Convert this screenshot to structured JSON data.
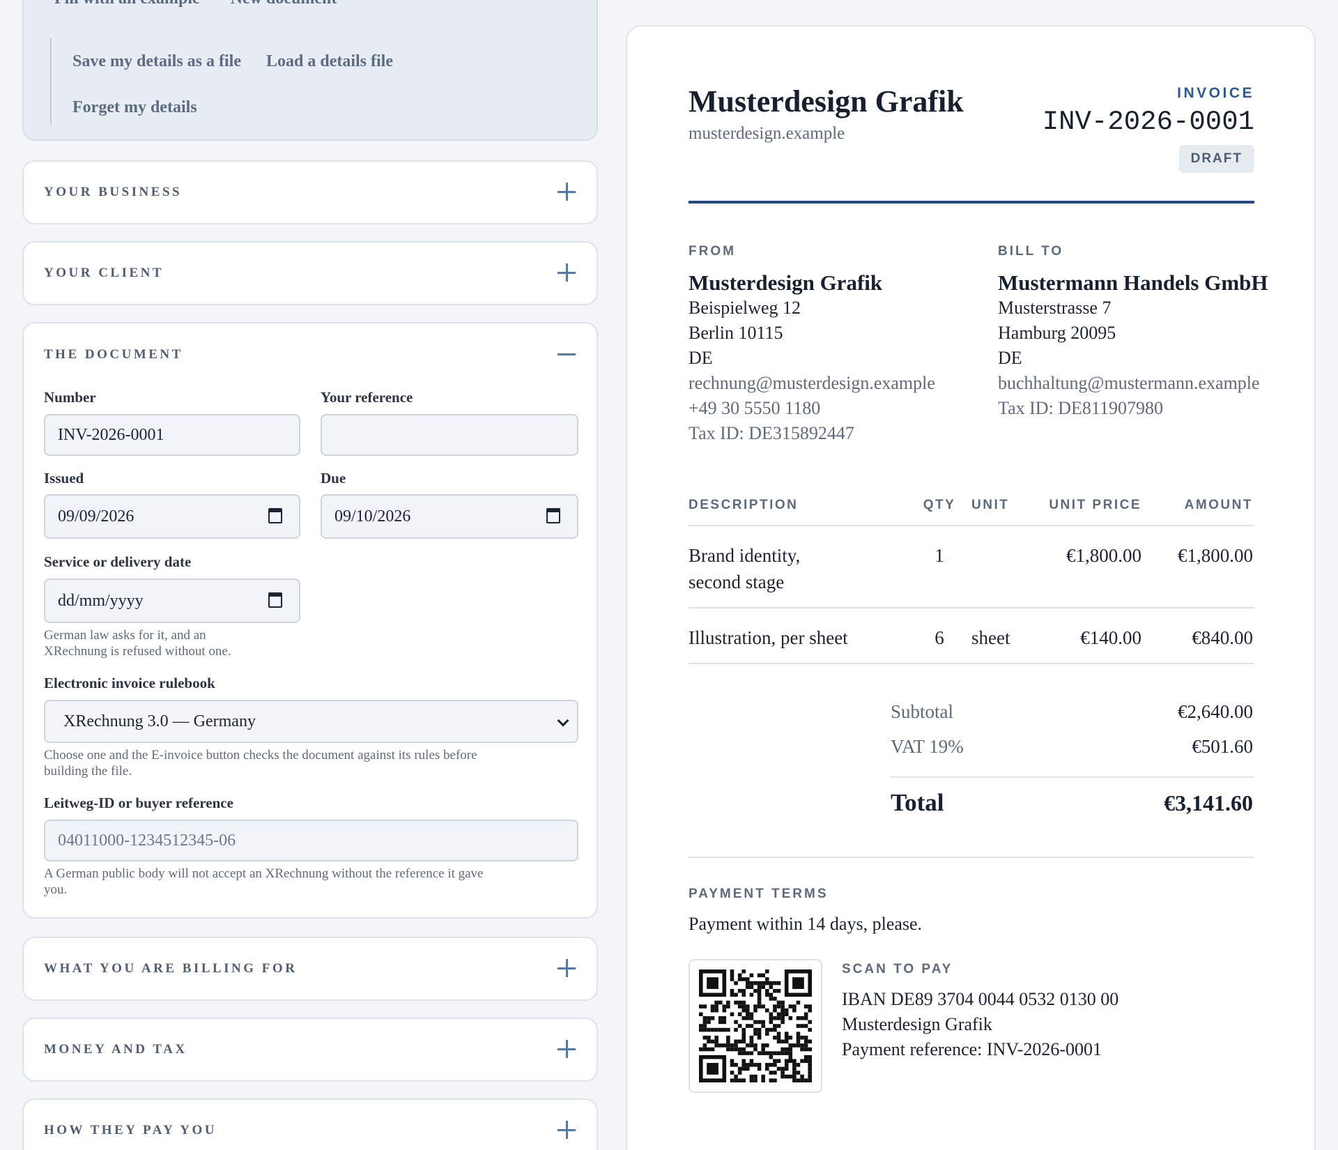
{
  "toolbar": {
    "fill_example": "Fill with an example",
    "new_document": "New document",
    "save_details": "Save my details as a file",
    "load_details": "Load a details file",
    "forget_details": "Forget my details"
  },
  "sections": {
    "your_business": "YOUR BUSINESS",
    "your_client": "YOUR CLIENT",
    "the_document": "THE DOCUMENT",
    "billing_for": "WHAT YOU ARE BILLING FOR",
    "money_tax": "MONEY AND TAX",
    "how_pay": "HOW THEY PAY YOU"
  },
  "document_form": {
    "number_label": "Number",
    "number_value": "INV-2026-0001",
    "reference_label": "Your reference",
    "reference_value": "",
    "issued_label": "Issued",
    "issued_value": "09/09/2026",
    "due_label": "Due",
    "due_value": "09/10/2026",
    "service_label": "Service or delivery date",
    "service_placeholder": "dd/mm/yyyy",
    "service_help_1": "German law asks for it, and an",
    "service_help_2": "XRechnung is refused without one.",
    "rulebook_label": "Electronic invoice rulebook",
    "rulebook_value": "XRechnung 3.0 — Germany",
    "rulebook_help_1": "Choose one and the E-invoice button checks the document against its rules before",
    "rulebook_help_2": "building the file.",
    "leitweg_label": "Leitweg-ID or buyer reference",
    "leitweg_placeholder": "04011000-1234512345-06",
    "leitweg_help_1": "A German public body will not accept an XRechnung without the reference it gave",
    "leitweg_help_2": "you."
  },
  "invoice": {
    "business_name": "Musterdesign Grafik",
    "business_site": "musterdesign.example",
    "kicker": "INVOICE",
    "number": "INV-2026-0001",
    "status": "DRAFT",
    "from_label": "FROM",
    "from": {
      "name": "Musterdesign Grafik",
      "street": "Beispielweg 12",
      "city": "Berlin 10115",
      "country": "DE",
      "email": "rechnung@musterdesign.example",
      "phone": "+49 30 5550 1180",
      "tax": "Tax ID: DE315892447"
    },
    "bill_to_label": "BILL TO",
    "to": {
      "name": "Mustermann Handels GmbH",
      "street": "Musterstrasse 7",
      "city": "Hamburg 20095",
      "country": "DE",
      "email": "buchhaltung@mustermann.example",
      "tax": "Tax ID: DE811907980"
    },
    "columns": {
      "description": "DESCRIPTION",
      "qty": "QTY",
      "unit": "UNIT",
      "unit_price": "UNIT PRICE",
      "amount": "AMOUNT"
    },
    "lines": [
      {
        "desc_1": "Brand identity,",
        "desc_2": "second stage",
        "qty": "1",
        "unit": "",
        "price": "€1,800.00",
        "amount": "€1,800.00"
      },
      {
        "desc_1": "Illustration, per sheet",
        "desc_2": "",
        "qty": "6",
        "unit": "sheet",
        "price": "€140.00",
        "amount": "€840.00"
      }
    ],
    "subtotal_label": "Subtotal",
    "subtotal": "€2,640.00",
    "vat_label": "VAT 19%",
    "vat": "€501.60",
    "total_label": "Total",
    "total": "€3,141.60",
    "terms_label": "PAYMENT TERMS",
    "terms": "Payment within 14 days, please.",
    "scan_label": "SCAN TO PAY",
    "iban": "IBAN DE89 3704 0044 0532 0130 00",
    "payee": "Musterdesign Grafik",
    "payment_ref": "Payment reference: INV-2026-0001"
  },
  "colors": {
    "accent": "#1f4a84",
    "icon": "#5678a7",
    "page_bg": "#f3f5f8"
  },
  "icons": [
    "plus-icon",
    "minus-icon",
    "calendar-icon",
    "chevron-down-icon",
    "qr-code-icon"
  ]
}
